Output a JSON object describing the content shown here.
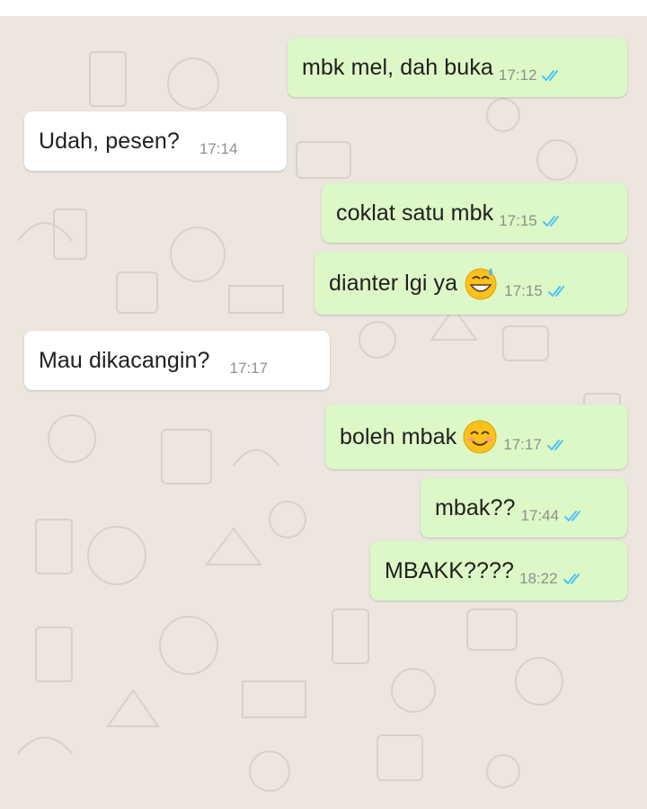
{
  "colors": {
    "wallpaper": "#ece6df",
    "outgoing_bubble": "#dcf8c6",
    "incoming_bubble": "#ffffff",
    "read_ticks": "#4fc3f7",
    "timestamp": "#8c918c"
  },
  "messages": [
    {
      "direction": "outgoing",
      "text": "mbk mel, dah buka",
      "time": "17:12",
      "status": "read-double-tick-icon"
    },
    {
      "direction": "incoming",
      "text": "Udah, pesen?",
      "time": "17:14"
    },
    {
      "direction": "outgoing",
      "text": "coklat satu mbk",
      "time": "17:15",
      "status": "read-double-tick-icon"
    },
    {
      "direction": "outgoing",
      "text": "dianter lgi ya",
      "emoji": "grinning-face-with-sweat-emoji",
      "time": "17:15",
      "status": "read-double-tick-icon"
    },
    {
      "direction": "incoming",
      "text": "Mau dikacangin?",
      "time": "17:17"
    },
    {
      "direction": "outgoing",
      "text": "boleh mbak",
      "emoji": "smiling-face-with-smiling-eyes-emoji",
      "time": "17:17",
      "status": "read-double-tick-icon"
    },
    {
      "direction": "outgoing",
      "text": "mbak??",
      "time": "17:44",
      "status": "read-double-tick-icon"
    },
    {
      "direction": "outgoing",
      "text": "MBAKK????",
      "time": "18:22",
      "status": "read-double-tick-icon"
    }
  ]
}
